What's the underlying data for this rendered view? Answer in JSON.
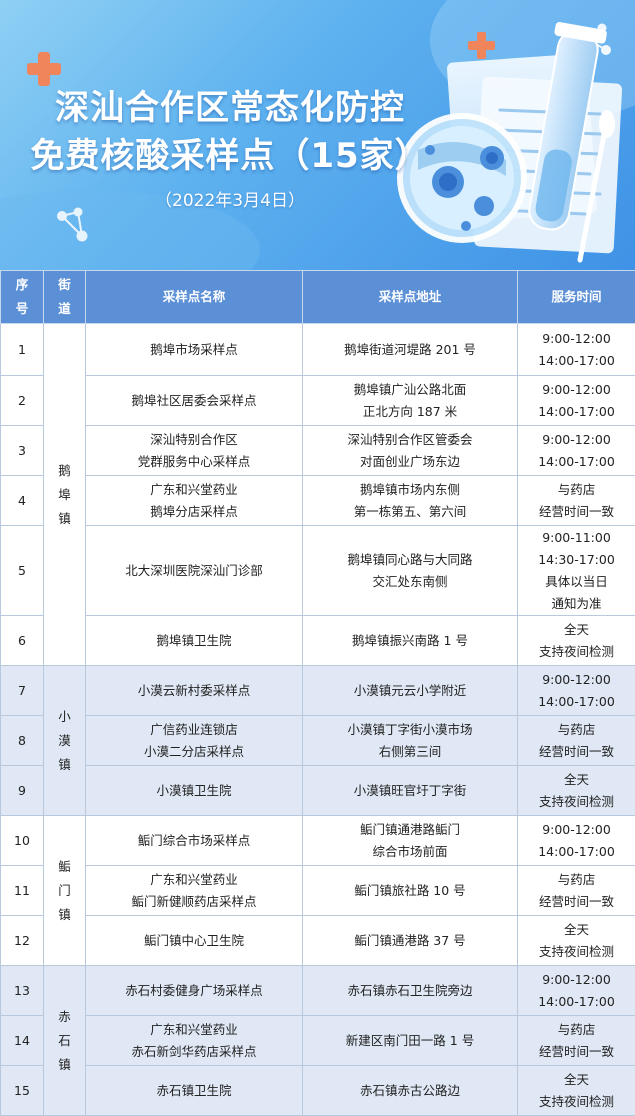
{
  "header": {
    "title_line1": "深汕合作区常态化防控",
    "title_line2": "免费核酸采样点（15家）",
    "date": "（2022年3月4日）"
  },
  "colors": {
    "header_bg": "#5b8fd6",
    "alt_row_bg": "#dfe8f4",
    "banner_light": "#8fd0f4",
    "banner_dark": "#3f92e6",
    "cross": "#f0845a"
  },
  "icons": [
    "medical-cross-icon",
    "molecule-icon",
    "magnifier-icon",
    "test-tube-icon",
    "swab-icon",
    "document-icon"
  ],
  "table": {
    "columns": [
      "序号",
      "街道",
      "采样点名称",
      "采样点地址",
      "服务时间"
    ],
    "towns": [
      {
        "name": "鹅埠镇",
        "rows": [
          {
            "no": "1",
            "name": [
              "鹅埠市场采样点"
            ],
            "addr": [
              "鹅埠街道河堤路 201 号"
            ],
            "time": [
              "9:00-12:00",
              "14:00-17:00"
            ]
          },
          {
            "no": "2",
            "name": [
              "鹅埠社区居委会采样点"
            ],
            "addr": [
              "鹅埠镇广汕公路北面",
              "正北方向 187 米"
            ],
            "time": [
              "9:00-12:00",
              "14:00-17:00"
            ]
          },
          {
            "no": "3",
            "name": [
              "深汕特别合作区",
              "党群服务中心采样点"
            ],
            "addr": [
              "深汕特别合作区管委会",
              "对面创业广场东边"
            ],
            "time": [
              "9:00-12:00",
              "14:00-17:00"
            ]
          },
          {
            "no": "4",
            "name": [
              "广东和兴堂药业",
              "鹅埠分店采样点"
            ],
            "addr": [
              "鹅埠镇市场内东侧",
              "第一栋第五、第六间"
            ],
            "time": [
              "与药店",
              "经营时间一致"
            ]
          },
          {
            "no": "5",
            "name": [
              "北大深圳医院深汕门诊部"
            ],
            "addr": [
              "鹅埠镇同心路与大同路",
              "交汇处东南侧"
            ],
            "time": [
              "9:00-11:00",
              "14:30-17:00",
              "具体以当日",
              "通知为准"
            ]
          },
          {
            "no": "6",
            "name": [
              "鹅埠镇卫生院"
            ],
            "addr": [
              "鹅埠镇振兴南路 1 号"
            ],
            "time": [
              "全天",
              "支持夜间检测"
            ]
          }
        ]
      },
      {
        "name": "小漠镇",
        "rows": [
          {
            "no": "7",
            "name": [
              "小漠云新村委采样点"
            ],
            "addr": [
              "小漠镇元云小学附近"
            ],
            "time": [
              "9:00-12:00",
              "14:00-17:00"
            ]
          },
          {
            "no": "8",
            "name": [
              "广信药业连锁店",
              "小漠二分店采样点"
            ],
            "addr": [
              "小漠镇丁字街小漠市场",
              "右侧第三间"
            ],
            "time": [
              "与药店",
              "经营时间一致"
            ]
          },
          {
            "no": "9",
            "name": [
              "小漠镇卫生院"
            ],
            "addr": [
              "小漠镇旺官圩丁字街"
            ],
            "time": [
              "全天",
              "支持夜间检测"
            ]
          }
        ]
      },
      {
        "name": "鲘门镇",
        "rows": [
          {
            "no": "10",
            "name": [
              "鲘门综合市场采样点"
            ],
            "addr": [
              "鲘门镇通港路鲘门",
              "综合市场前面"
            ],
            "time": [
              "9:00-12:00",
              "14:00-17:00"
            ]
          },
          {
            "no": "11",
            "name": [
              "广东和兴堂药业",
              "鲘门新健顺药店采样点"
            ],
            "addr": [
              "鲘门镇旅社路 10 号"
            ],
            "time": [
              "与药店",
              "经营时间一致"
            ]
          },
          {
            "no": "12",
            "name": [
              "鲘门镇中心卫生院"
            ],
            "addr": [
              "鲘门镇通港路 37 号"
            ],
            "time": [
              "全天",
              "支持夜间检测"
            ]
          }
        ]
      },
      {
        "name": "赤石镇",
        "rows": [
          {
            "no": "13",
            "name": [
              "赤石村委健身广场采样点"
            ],
            "addr": [
              "赤石镇赤石卫生院旁边"
            ],
            "time": [
              "9:00-12:00",
              "14:00-17:00"
            ]
          },
          {
            "no": "14",
            "name": [
              "广东和兴堂药业",
              "赤石新剑华药店采样点"
            ],
            "addr": [
              "新建区南门田一路 1 号"
            ],
            "time": [
              "与药店",
              "经营时间一致"
            ]
          },
          {
            "no": "15",
            "name": [
              "赤石镇卫生院"
            ],
            "addr": [
              "赤石镇赤古公路边"
            ],
            "time": [
              "全天",
              "支持夜间检测"
            ]
          }
        ]
      }
    ]
  }
}
